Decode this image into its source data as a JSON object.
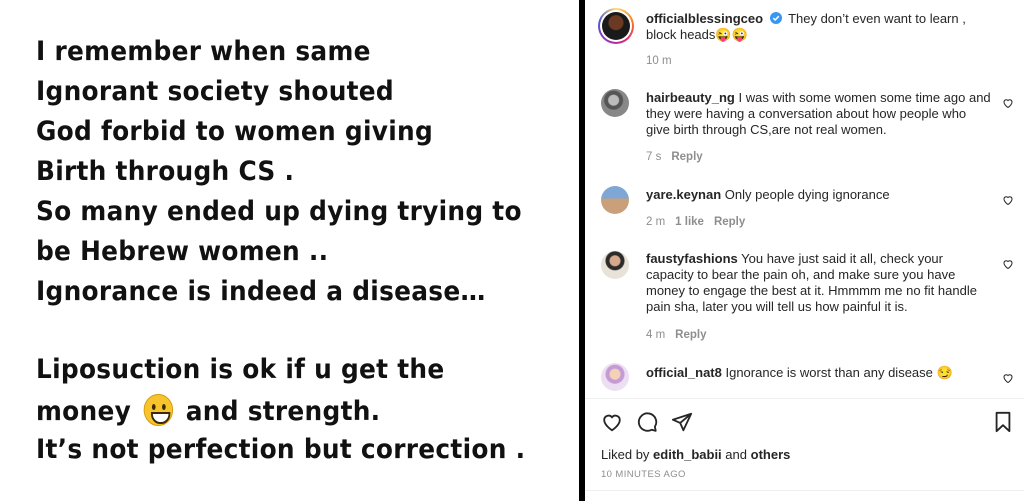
{
  "poster": {
    "lines": [
      "I remember when same",
      "Ignorant society shouted",
      "God forbid to women giving",
      "Birth through CS .",
      "So many ended up dying trying to",
      "be Hebrew women ..",
      "Ignorance is indeed a disease…",
      "Liposuction is ok if u get the",
      "money",
      "and strength.",
      "It’s not perfection but correction ."
    ],
    "emoji": "grinning-face-emoji"
  },
  "post": {
    "author": "officialblessingceo",
    "verified": true,
    "caption": "They don’t even want to learn , block heads😜😜",
    "age": "10 m"
  },
  "comments": [
    {
      "username": "hairbeauty_ng",
      "text": "I was with some women some time ago and they were having a conversation about how people who give birth through CS,are not real women.",
      "age": "7 s",
      "likes": "",
      "reply": "Reply"
    },
    {
      "username": "yare.keynan",
      "text": "Only people dying ignorance",
      "age": "2 m",
      "likes": "1 like",
      "reply": "Reply"
    },
    {
      "username": "faustyfashions",
      "text": "You have just said it all, check your capacity to bear the pain oh, and make sure you have money to engage the best at it. Hmmmm me no fit handle pain sha, later you will tell us how painful it is.",
      "age": "4 m",
      "likes": "",
      "reply": "Reply"
    },
    {
      "username": "official_nat8",
      "text": "Ignorance is worst than any disease 😏",
      "age": "",
      "likes": "",
      "reply": ""
    }
  ],
  "likes": {
    "prefix": "Liked by",
    "user": "edith_babii",
    "joiner": "and",
    "others": "others"
  },
  "timestamp": "10 MINUTES AGO",
  "icons": [
    "heart-icon",
    "comment-icon",
    "share-icon",
    "bookmark-icon",
    "verified-badge-icon"
  ],
  "colors": {
    "verified": "#3897f0",
    "muted": "#8e8e8e",
    "text": "#262626"
  }
}
